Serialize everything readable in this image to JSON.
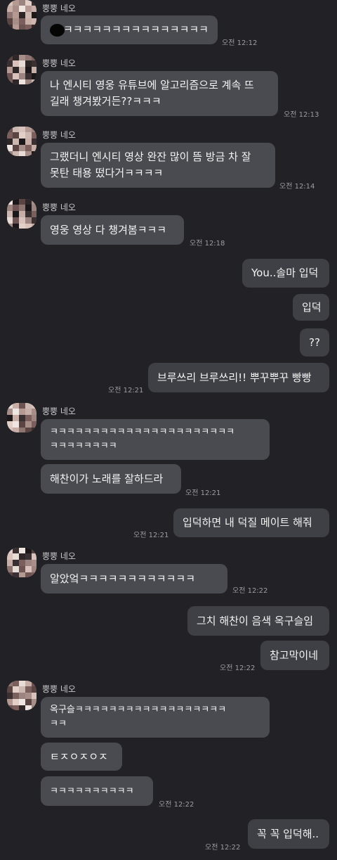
{
  "sender_name": "뿡뿡 네오",
  "messages": [
    {
      "text": "ㅋㅋㅋㅋㅋㅋㅋㅋㅋㅋㅋㅋㅋㅋㅋ",
      "time": "오전 12:12"
    },
    {
      "line1": "나 엔시티 영웅 유튜브에 알고리즘으로 계속 뜨",
      "line2": "길래 챙겨봤거든??ㅋㅋㅋ",
      "time": "오전 12:13"
    },
    {
      "line1": "그랬더니 엔시티 영상 완잔 많이 뜸 방금 차 잘",
      "line2": "못탄 태용 떴다거ㅋㅋㅋㅋ",
      "time": "오전 12:14"
    },
    {
      "text": "영웅 영상 다 챙겨봄ㅋㅋㅋ",
      "time": "오전 12:18"
    },
    {
      "text": "You..솔마 입덕"
    },
    {
      "text": "입덕"
    },
    {
      "text": "??"
    },
    {
      "text": "브루쓰리 브루쓰리!! 뿌꾸뿌꾸 빵빵",
      "time": "오전 12:21"
    },
    {
      "line1": "ㅋㅋㅋㅋㅋㅋㅋㅋㅋㅋㅋㅋㅋㅋㅋㅋㅋㅋㅋㅋㅋㅋ",
      "line2": "ㅋㅋㅋㅋㅋㅋㅋㅋ"
    },
    {
      "text": "해찬이가 노래를 잘하드라",
      "time": "오전 12:21"
    },
    {
      "text": "입덕하면 내 덕질 메이트 해줘",
      "time": "오전 12:21"
    },
    {
      "text": "알았엌ㅋㅋㅋㅋㅋㅋㅋㅋㅋㅋㅋㅋ",
      "time": "오전 12:22"
    },
    {
      "text": "그치 해찬이 음색 옥구슬임"
    },
    {
      "text": "참고막이네",
      "time": "오전 12:22"
    },
    {
      "line1": "옥구슬ㅋㅋㅋㅋㅋㅋㅋㅋㅋㅋㅋㅋㅋㅋㅋㅋㅋㅋ",
      "line2": "ㅋㅋ"
    },
    {
      "text": "ㅌㅈㅇㅈㅇㅈ"
    },
    {
      "text": "ㅋㅋㅋㅋㅋㅋㅋㅋㅋㅋ",
      "time": "오전 12:22"
    },
    {
      "text": "꼭 꼭 입덕해..",
      "time": "오전 12:22"
    }
  ]
}
